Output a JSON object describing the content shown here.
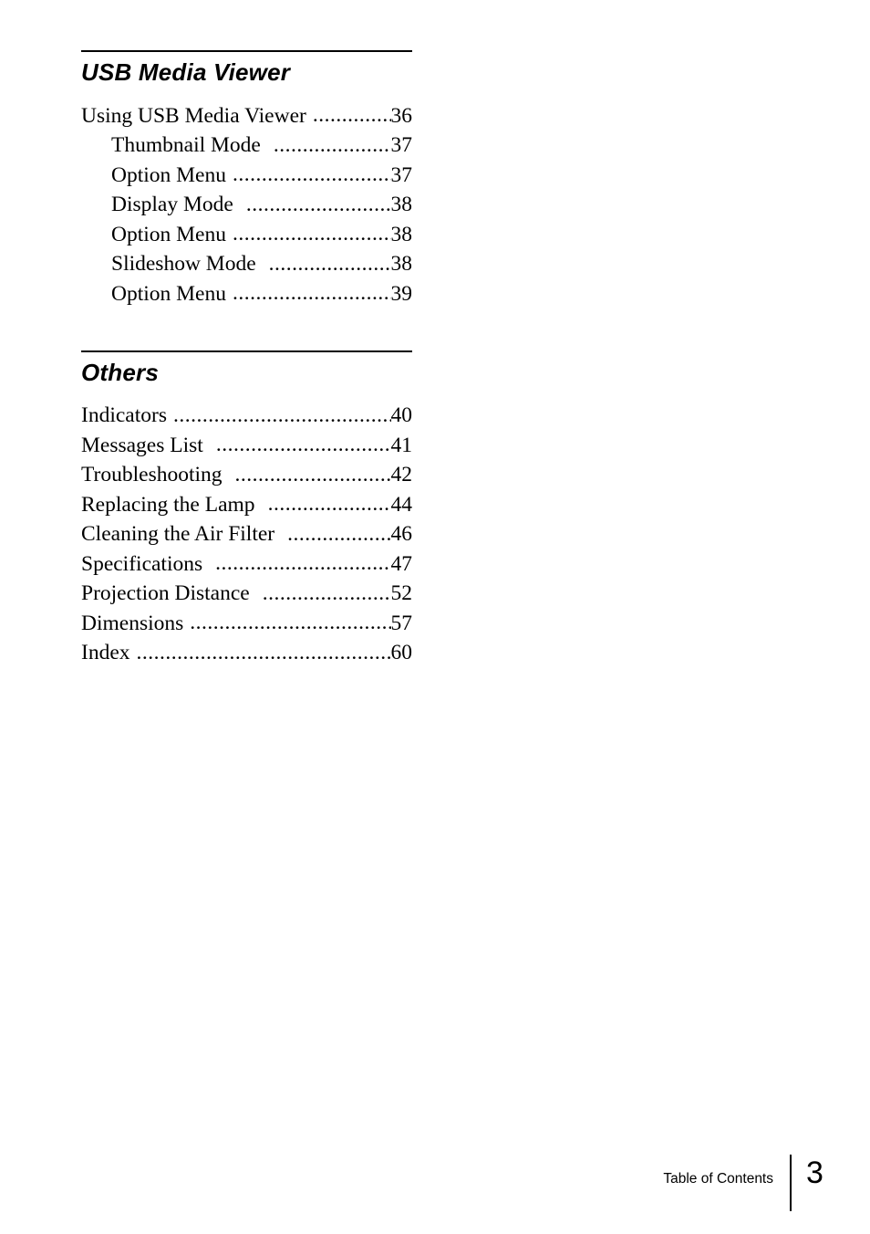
{
  "document": {
    "type": "table-of-contents"
  },
  "sections": [
    {
      "title": "USB Media Viewer",
      "entries": [
        {
          "label": "Using USB Media Viewer",
          "page": "36",
          "level": 1,
          "wide_gap": false
        },
        {
          "label": "Thumbnail Mode",
          "page": "37",
          "level": 2,
          "wide_gap": true
        },
        {
          "label": "Option Menu",
          "page": "37",
          "level": 2,
          "wide_gap": false
        },
        {
          "label": "Display Mode",
          "page": "38",
          "level": 2,
          "wide_gap": true
        },
        {
          "label": "Option Menu",
          "page": "38",
          "level": 2,
          "wide_gap": false
        },
        {
          "label": "Slideshow Mode",
          "page": "38",
          "level": 2,
          "wide_gap": true
        },
        {
          "label": "Option Menu",
          "page": "39",
          "level": 2,
          "wide_gap": false
        }
      ]
    },
    {
      "title": "Others",
      "entries": [
        {
          "label": "Indicators",
          "page": "40",
          "level": 1,
          "wide_gap": false
        },
        {
          "label": "Messages List",
          "page": "41",
          "level": 1,
          "wide_gap": true
        },
        {
          "label": "Troubleshooting",
          "page": "42",
          "level": 1,
          "wide_gap": true
        },
        {
          "label": "Replacing the Lamp",
          "page": "44",
          "level": 1,
          "wide_gap": true
        },
        {
          "label": "Cleaning the Air Filter",
          "page": "46",
          "level": 1,
          "wide_gap": true
        },
        {
          "label": "Specifications",
          "page": "47",
          "level": 1,
          "wide_gap": true
        },
        {
          "label": "Projection Distance",
          "page": "52",
          "level": 1,
          "wide_gap": true
        },
        {
          "label": "Dimensions",
          "page": "57",
          "level": 1,
          "wide_gap": false
        },
        {
          "label": "Index",
          "page": "60",
          "level": 1,
          "wide_gap": false
        }
      ]
    }
  ],
  "footer": {
    "label": "Table of Contents",
    "page_number": "3"
  }
}
